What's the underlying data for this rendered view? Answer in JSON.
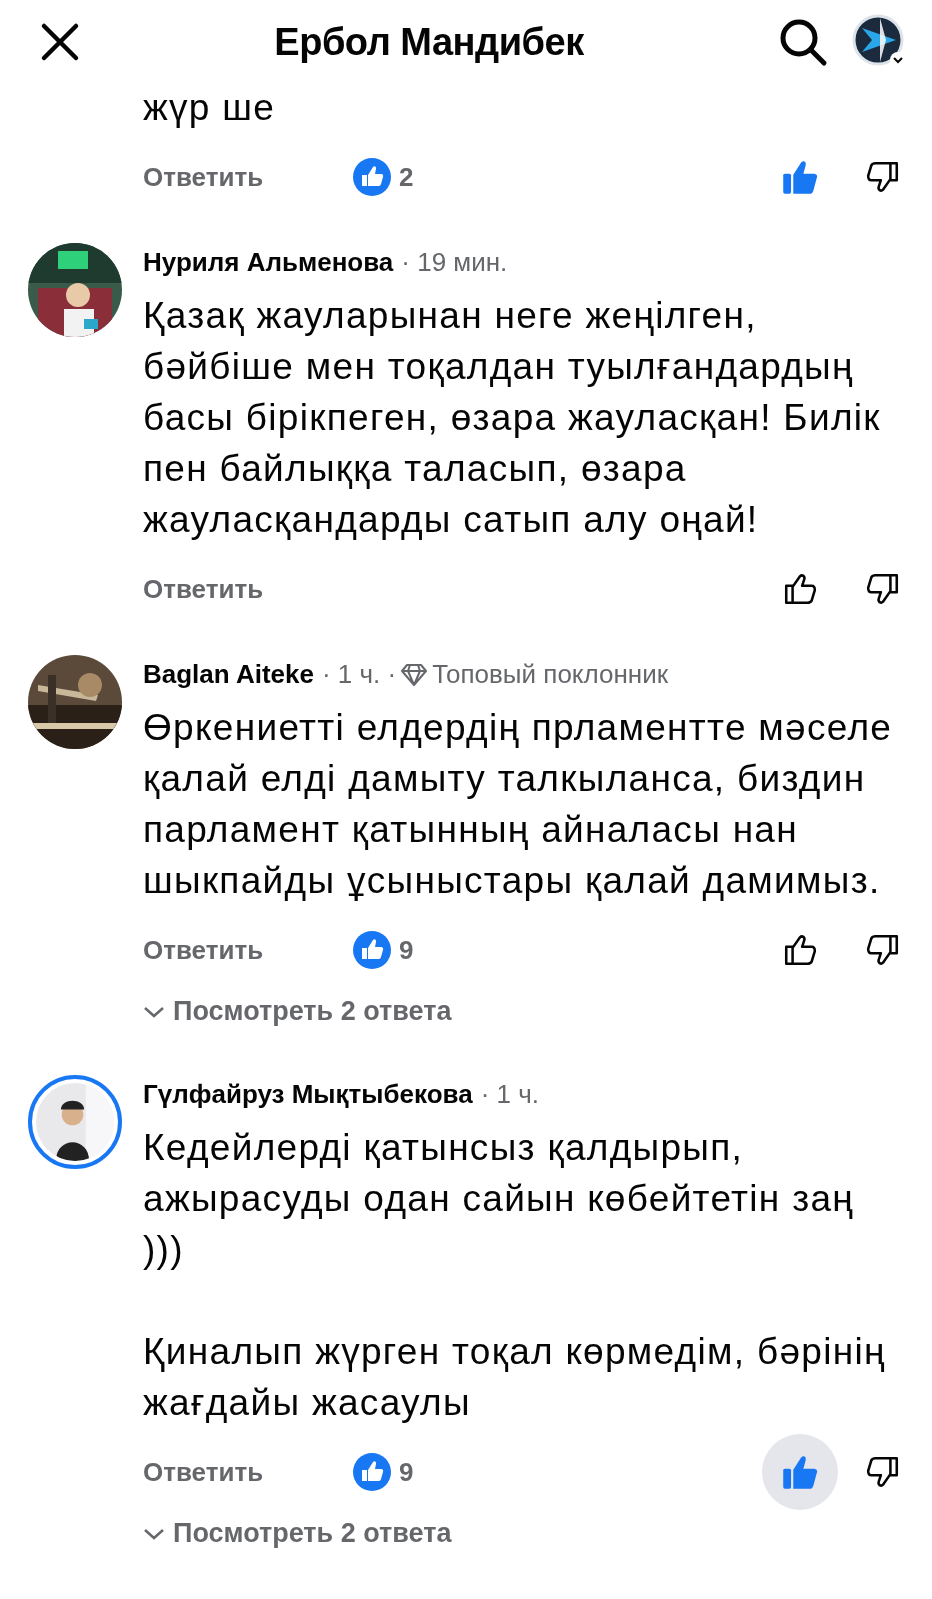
{
  "header": {
    "title": "Ербол Мандибек"
  },
  "comments": [
    {
      "paragraphs": [
        "жүр ше"
      ],
      "reply": "Ответить",
      "reactions": "2",
      "liked": true,
      "like_pressed": false
    },
    {
      "author": "Нуриля Альменова",
      "time": "· 19 мин.",
      "story_ring": false,
      "paragraphs": [
        "Қазақ жауларынан неге жеңілген, бәйбіше мен тоқалдан туылғандардың басы бірікпеген, өзара жауласқан! Билік пен байлыққа таласып, өзара жауласқандарды сатып алу оңай!"
      ],
      "reply": "Ответить",
      "liked": false,
      "like_pressed": false
    },
    {
      "author": "Baglan Aiteke",
      "time": "· 1 ч. ·",
      "badge": "Топовый поклонник",
      "story_ring": false,
      "paragraphs": [
        "Өркениетті елдердің прламентте мәселе қалай елді дамыту талкыланса, биздин парламент қатынның айналасы нан шыкпайды ұсыныстары қалай дамимыз."
      ],
      "reply": "Ответить",
      "reactions": "9",
      "liked": false,
      "like_pressed": false,
      "view_replies": "Посмотреть 2 ответа"
    },
    {
      "author": "Гүлфайруз Мықтыбекова",
      "time": "· 1 ч.",
      "story_ring": true,
      "paragraphs": [
        "Кедейлерді қатынсыз қалдырып, ажырасуды одан сайын көбейтетін заң )))",
        "Қиналып жүрген тоқал көрмедім, бәрінің жағдайы жасаулы"
      ],
      "reply": "Ответить",
      "reactions": "9",
      "liked": true,
      "like_pressed": true,
      "view_replies": "Посмотреть 2 ответа"
    }
  ]
}
